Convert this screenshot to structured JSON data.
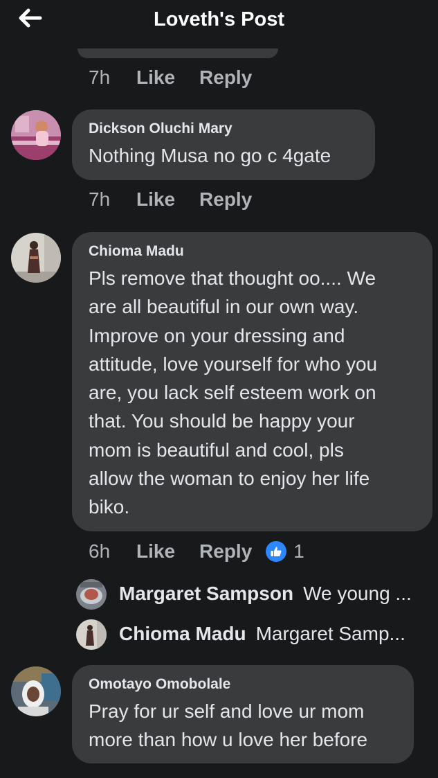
{
  "header": {
    "title": "Loveth's Post",
    "back_icon": "arrow-left-icon"
  },
  "actions": {
    "like": "Like",
    "reply": "Reply"
  },
  "comments": [
    {
      "time": "7h"
    },
    {
      "author": "Dickson Oluchi Mary",
      "text": "Nothing Musa no go c 4gate",
      "time": "7h"
    },
    {
      "author": "Chioma Madu",
      "text": "Pls remove that thought oo.... We\nare all beautiful in our own way.\nImprove on your dressing and\nattitude,  love yourself for who you\nare, you lack self esteem  work on\nthat.  You should be happy your\nmom is beautiful and cool,   pls\nallow the woman to enjoy her life\nbiko.",
      "time": "6h",
      "reaction_icon": "thumbs-up-icon",
      "reaction_count": "1",
      "replies": [
        {
          "author": "Margaret Sampson",
          "text": "We young ..."
        },
        {
          "author": "Chioma Madu",
          "text": "Margaret Samp..."
        }
      ]
    },
    {
      "author": "Omotayo Omobolale",
      "text": "Pray for ur self and love ur mom\nmore than how u love her before"
    }
  ],
  "colors": {
    "background": "#18191a",
    "bubble": "#3a3b3c",
    "text": "#e4e6eb",
    "secondary_text": "#b0b3b8",
    "reaction_blue": "#2d88ff"
  }
}
